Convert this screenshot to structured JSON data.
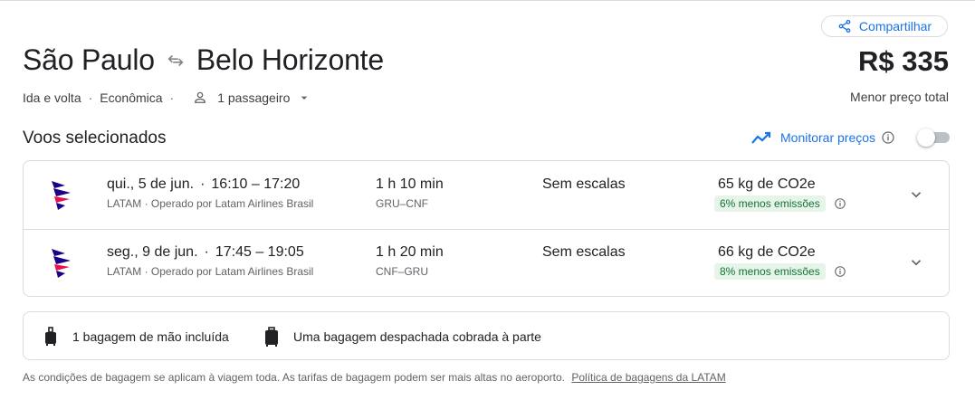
{
  "header": {
    "share_label": "Compartilhar",
    "origin": "São Paulo",
    "destination": "Belo Horizonte",
    "price": "R$ 335",
    "price_caption": "Menor preço total",
    "trip_type": "Ida e volta",
    "cabin_class": "Econômica",
    "passengers": "1 passageiro"
  },
  "section": {
    "title": "Voos selecionados",
    "monitor_label": "Monitorar preços",
    "monitor_enabled": false
  },
  "flights": [
    {
      "date": "qui., 5 de jun.",
      "times": "16:10 – 17:20",
      "airline": "LATAM",
      "operator": "Operado por Latam Airlines Brasil",
      "duration": "1 h 10 min",
      "route": "GRU–CNF",
      "stops": "Sem escalas",
      "co2": "65 kg de CO2e",
      "emissions": "6% menos emissões"
    },
    {
      "date": "seg., 9 de jun.",
      "times": "17:45 – 19:05",
      "airline": "LATAM",
      "operator": "Operado por Latam Airlines Brasil",
      "duration": "1 h 20 min",
      "route": "CNF–GRU",
      "stops": "Sem escalas",
      "co2": "66 kg de CO2e",
      "emissions": "8% menos emissões"
    }
  ],
  "baggage": {
    "carry_on": "1 bagagem de mão incluída",
    "checked": "Uma bagagem despachada cobrada à parte"
  },
  "footnote": {
    "text": "As condições de bagagem se aplicam à viagem toda. As tarifas de bagagem podem ser mais altas no aeroporto.",
    "link": "Política de bagagens da LATAM"
  },
  "colors": {
    "accent": "#1a73e8",
    "emissions_bg": "#e6f4ea",
    "emissions_text": "#137333",
    "latam_indigo": "#1b0088",
    "latam_coral": "#e8114b"
  }
}
